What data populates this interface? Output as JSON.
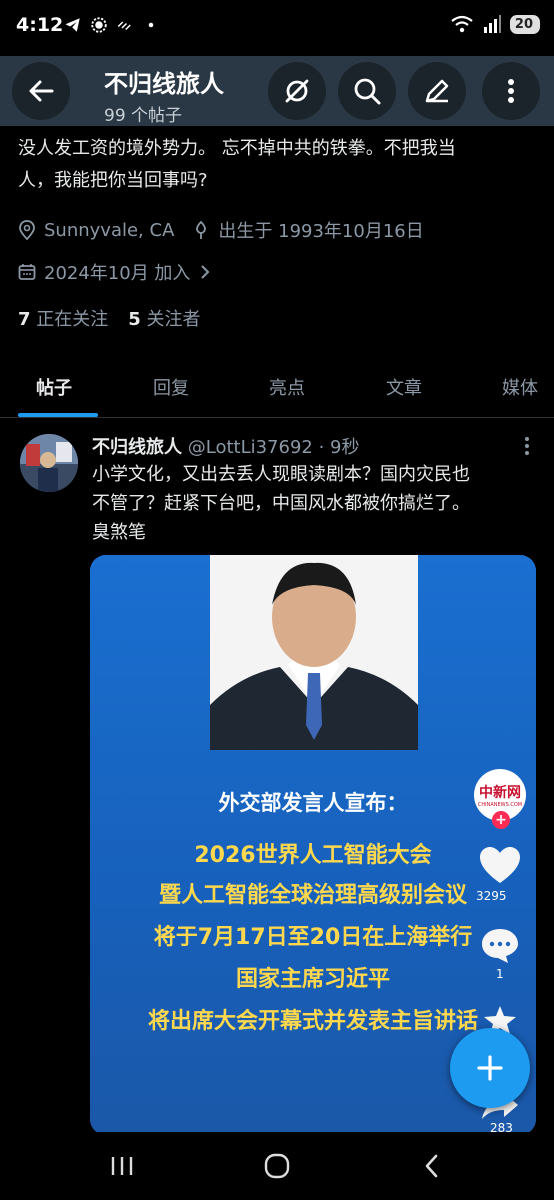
{
  "status_bar": {
    "time": "4:12",
    "battery": "20",
    "network": "6"
  },
  "header": {
    "title": "不归线旅人",
    "post_count": "99 个帖子",
    "icons": [
      "back-arrow-icon",
      "hide-icon",
      "search-icon",
      "edit-icon",
      "more-vertical-icon"
    ]
  },
  "profile": {
    "bio_line1": "没人发工资的境外势力。 忘不掉中共的铁拳。不把我当",
    "bio_line2": "人，我能把你当回事吗?",
    "location": "Sunnyvale, CA",
    "birthday": "出生于 1993年10月16日",
    "joined": "2024年10月 加入",
    "following_count": "7",
    "following_label": "正在关注",
    "followers_count": "5",
    "followers_label": "关注者"
  },
  "tabs": [
    {
      "label": "帖子",
      "active": true
    },
    {
      "label": "回复",
      "active": false
    },
    {
      "label": "亮点",
      "active": false
    },
    {
      "label": "文章",
      "active": false
    },
    {
      "label": "媒体",
      "active": false
    }
  ],
  "post": {
    "author": "不归线旅人",
    "handle": "@LottLi37692 · 9秒",
    "text_line1": "小学文化，又出去丢人现眼读剧本？国内灾民也",
    "text_line2": "不管了？赶紧下台吧，中国风水都被你搞烂了。",
    "text_line3": "臭煞笔",
    "media": {
      "lines": [
        "外交部发言人宣布：",
        "2026世界人工智能大会",
        "暨人工智能全球治理高级别会议",
        "将于7月17日至20日在上海举行",
        "国家主席习近平",
        "将出席大会开幕式并发表主旨讲话"
      ],
      "logo_text": "中新网",
      "logo_sub": "CHINANEWS.COM",
      "like_count": "3295",
      "comment_count": "1",
      "share_count": "283"
    }
  },
  "colors": {
    "accent": "#1d9bf0",
    "header_bg": "#2a3845",
    "media_blue": "#1c66c1",
    "media_yellow": "#ffd84d"
  }
}
